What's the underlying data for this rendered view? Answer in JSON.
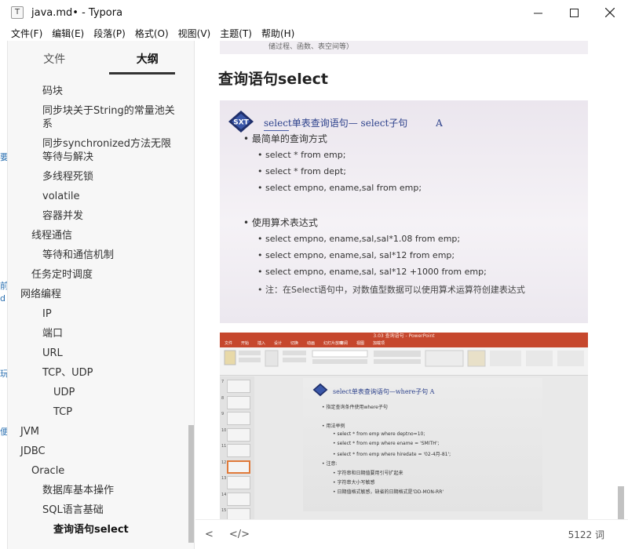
{
  "window": {
    "title": "java.md• - Typora",
    "app_icon": "T",
    "controls": [
      "minimize-icon",
      "maximize-icon",
      "close-icon"
    ]
  },
  "menu": [
    "文件(F)",
    "编辑(E)",
    "段落(P)",
    "格式(O)",
    "视图(V)",
    "主题(T)",
    "帮助(H)"
  ],
  "left_strip": [
    "要",
    "前",
    "d",
    "玩",
    "便"
  ],
  "sidebar": {
    "tabs": [
      {
        "label": "文件",
        "active": false
      },
      {
        "label": "大纲",
        "active": true
      }
    ],
    "outline": [
      {
        "label": "码块",
        "depth": 3
      },
      {
        "label": "同步块关于String的常量池关系",
        "depth": 3
      },
      {
        "label": "同步synchronized方法无限等待与解决",
        "depth": 3
      },
      {
        "label": "多线程死锁",
        "depth": 3
      },
      {
        "label": "volatile",
        "depth": 3
      },
      {
        "label": "容器并发",
        "depth": 3
      },
      {
        "label": "线程通信",
        "depth": 2
      },
      {
        "label": "等待和通信机制",
        "depth": 3
      },
      {
        "label": "任务定时调度",
        "depth": 2
      },
      {
        "label": "网络编程",
        "depth": 1
      },
      {
        "label": "IP",
        "depth": 3
      },
      {
        "label": "端口",
        "depth": 3
      },
      {
        "label": "URL",
        "depth": 3
      },
      {
        "label": "TCP、UDP",
        "depth": 3
      },
      {
        "label": "UDP",
        "depth": 4
      },
      {
        "label": "TCP",
        "depth": 4
      },
      {
        "label": "JVM",
        "depth": 1
      },
      {
        "label": "JDBC",
        "depth": 1
      },
      {
        "label": "Oracle",
        "depth": 2
      },
      {
        "label": "数据库基本操作",
        "depth": 3
      },
      {
        "label": "SQL语言基础",
        "depth": 3
      },
      {
        "label": "查询语句select",
        "depth": 4,
        "active": true
      }
    ]
  },
  "editor": {
    "prev_image_caption": "储过程、函数、表空间等）",
    "heading": "查询语句select",
    "slide": {
      "logo": "SXT",
      "title": "select单表查询语句— select子句",
      "title_suffix": "A",
      "lines": [
        {
          "text": "• 最简单的查询方式",
          "level": 1
        },
        {
          "text": "• select * from emp;",
          "level": 2
        },
        {
          "text": "• select * from dept;",
          "level": 2
        },
        {
          "text": "• select empno, ename,sal  from emp;",
          "level": 2
        },
        {
          "text": "• 使用算术表达式",
          "level": 1
        },
        {
          "text": "• select empno, ename,sal,sal*1.08 from emp;",
          "level": 2
        },
        {
          "text": "• select empno, ename,sal, sal*12 from emp;",
          "level": 2
        },
        {
          "text": "• select empno, ename,sal, sal*12 +1000 from emp;",
          "level": 2
        },
        {
          "text": "• 注：在Select语句中，对数值型数据可以使用算术运算符创建表达式",
          "level": 2,
          "note": true
        }
      ]
    },
    "ppt": {
      "window_title": "3.03 查询语句 - PowerPoint",
      "tabs": [
        "文件",
        "开始",
        "插入",
        "设计",
        "切换",
        "动画",
        "幻灯片放映",
        "审阅",
        "视图",
        "加载项"
      ],
      "thumb_numbers": [
        "7",
        "8",
        "9",
        "10",
        "11",
        "12",
        "13",
        "14",
        "15"
      ],
      "slide_title": "select单表查询语句—where子句   A",
      "lines": [
        "• 指定查询条件使用where子句",
        "• 用法举例",
        "• select * from emp where deptno=10;",
        "• select * from emp where ename = 'SMITH';",
        "• select * from emp where hiredate = '02-4月-81';",
        "• 注意:",
        "• 字符串和日期值要用引号扩起来",
        "• 字符串大小写敏感",
        "• 日期值格式敏感，缺省的日期格式是'DD-MON-RR'"
      ]
    }
  },
  "statusbar": {
    "back_icon": "<",
    "source_icon": "</>",
    "word_count": "5122 词"
  }
}
